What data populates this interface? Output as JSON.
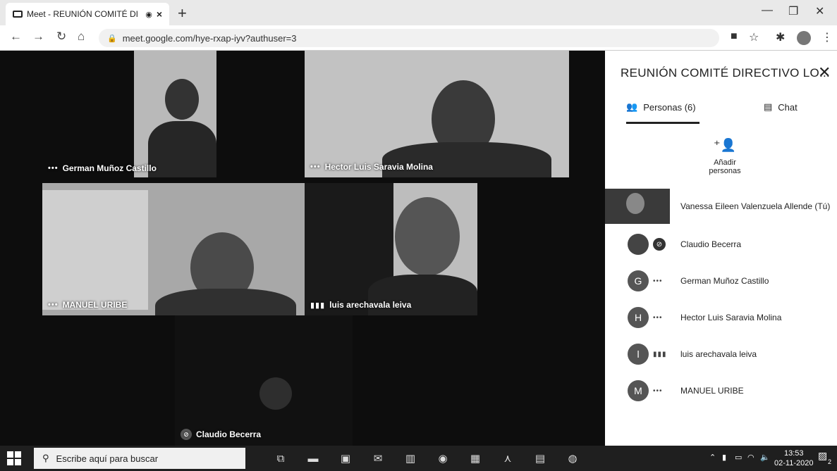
{
  "browser": {
    "tab_title": "Meet - REUNIÓN COMITÉ DI",
    "url": "meet.google.com/hye-rxap-iyv?authuser=3"
  },
  "meeting": {
    "tiles": [
      {
        "name": "German Muñoz Castillo",
        "status": "•••"
      },
      {
        "name": "Hector Luis Saravia Molina",
        "status": "•••"
      },
      {
        "name": "MANUEL URIBE",
        "status": "•••"
      },
      {
        "name": "luis arechavala leiva",
        "status": "▮▮▮"
      },
      {
        "name": "Claudio Becerra",
        "status": "muted"
      }
    ]
  },
  "panel": {
    "title": "REUNIÓN COMITÉ DIRECTIVO LO...",
    "tab_people": "Personas (6)",
    "tab_chat": "Chat",
    "add_people": "Añadir personas",
    "participants": [
      {
        "name": "Vanessa Eileen Valenzuela Allende (Tú)",
        "initial": "",
        "type": "photo"
      },
      {
        "name": "Claudio Becerra",
        "initial": "",
        "type": "muted"
      },
      {
        "name": "German Muñoz Castillo",
        "initial": "G",
        "type": "more"
      },
      {
        "name": "Hector Luis Saravia Molina",
        "initial": "H",
        "type": "more"
      },
      {
        "name": "luis arechavala leiva",
        "initial": "l",
        "type": "audio"
      },
      {
        "name": "MANUEL URIBE",
        "initial": "M",
        "type": "more"
      }
    ]
  },
  "taskbar": {
    "search_placeholder": "Escribe aquí para buscar",
    "time": "13:53",
    "date": "02-11-2020",
    "notifications": "2"
  }
}
